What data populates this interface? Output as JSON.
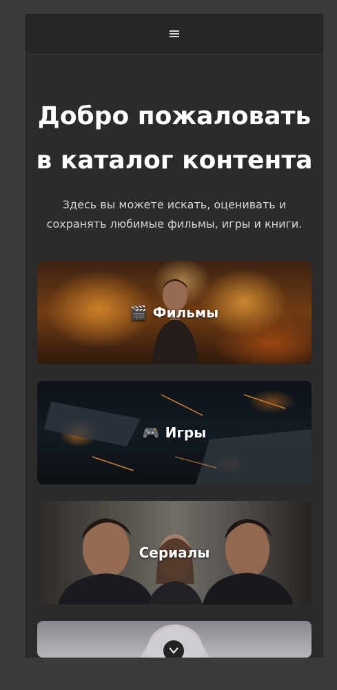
{
  "navbar": {
    "menu_icon": "hamburger-icon"
  },
  "hero": {
    "title": "Добро пожаловать в каталог контента",
    "subtitle": "Здесь вы можете искать, оценивать и сохранять любимые фильмы, игры и книги."
  },
  "cards": [
    {
      "label": "Фильмы",
      "icon": "🎬"
    },
    {
      "label": "Игры",
      "icon": "🎮"
    },
    {
      "label": "Сериалы",
      "icon": ""
    }
  ],
  "scroll_icon": "chevron-down-icon"
}
